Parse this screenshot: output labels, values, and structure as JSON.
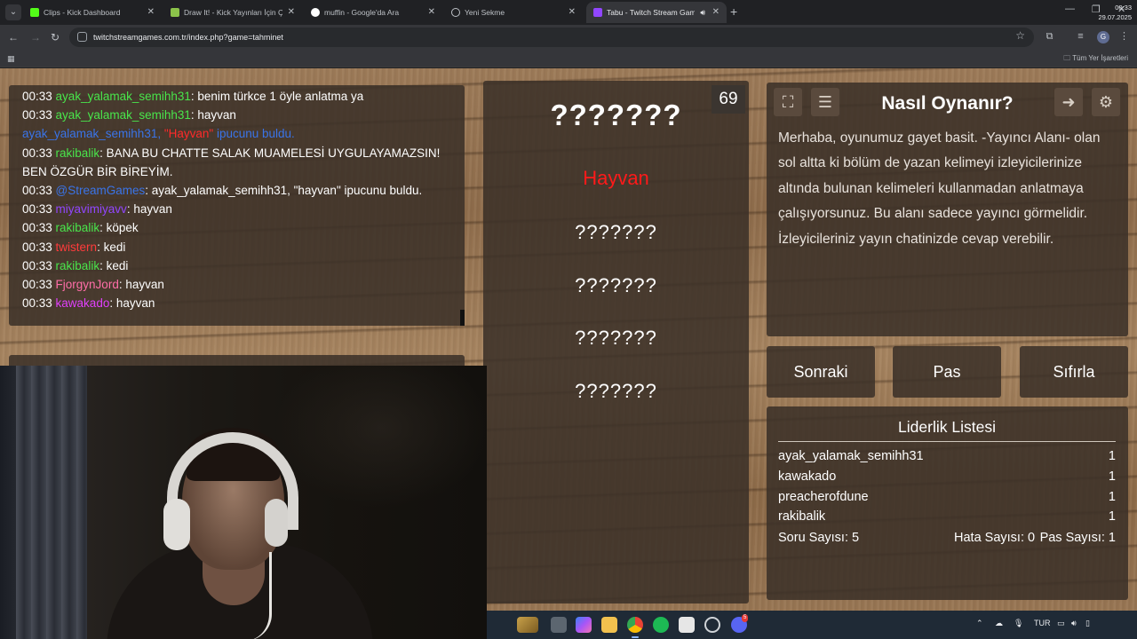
{
  "browser": {
    "tabs": [
      {
        "title": "Clips - Kick Dashboard",
        "favicon_color": "#53fc18"
      },
      {
        "title": "Draw It! - Kick Yayınları İçin Çizim",
        "favicon_color": "#8bc34a"
      },
      {
        "title": "muffin - Google'da Ara",
        "favicon_color": "#ffffff"
      },
      {
        "title": "Yeni Sekme",
        "favicon_color": "#bdc1c6"
      },
      {
        "title": "Tabu - Twitch Stream Games",
        "favicon_color": "#9146ff"
      }
    ],
    "url": "twitchstreamgames.com.tr/index.php?game=tahminet",
    "bookmarks_all_label": "Tüm Yer İşaretleri",
    "profile_initial": "G"
  },
  "chat": {
    "messages": [
      {
        "time": "00:33",
        "user": "ayak_yalamak_semihh31",
        "user_color": "#49e54b",
        "text": ": benim türkce 1 öyle anlatma ya",
        "text_color": "#ffffff"
      },
      {
        "time": "00:33",
        "user": "ayak_yalamak_semihh31",
        "user_color": "#49e54b",
        "text": ": hayvan",
        "text_color": "#ffffff"
      },
      {
        "time": "",
        "user": "ayak_yalamak_semihh31",
        "user_color": "#3a74e8",
        "text": ", \"Hayvan\" ipucunu buldu.",
        "text_color": "#3a74e8",
        "hint_word": "\"Hayvan\"",
        "system": true
      },
      {
        "time": "00:33",
        "user": "rakibalik",
        "user_color": "#49e54b",
        "text": ": BANA BU CHATTE SALAK MUAMELESİ UYGULAYAMAZSIN! BEN ÖZGÜR BİR BİREYİM.",
        "text_color": "#ffffff"
      },
      {
        "time": "00:33",
        "user": "@StreamGames",
        "user_color": "#3a74e8",
        "text": ": ayak_yalamak_semihh31, \"hayvan\" ipucunu buldu.",
        "text_color": "#ffffff"
      },
      {
        "time": "00:33",
        "user": "miyavimiyavv",
        "user_color": "#9146ff",
        "text": ": hayvan",
        "text_color": "#ffffff"
      },
      {
        "time": "00:33",
        "user": "rakibalik",
        "user_color": "#49e54b",
        "text": ": köpek",
        "text_color": "#ffffff"
      },
      {
        "time": "00:33",
        "user": "twistern",
        "user_color": "#ff3b3b",
        "text": ": kedi",
        "text_color": "#ffffff"
      },
      {
        "time": "00:33",
        "user": "rakibalik",
        "user_color": "#49e54b",
        "text": ": kedi",
        "text_color": "#ffffff"
      },
      {
        "time": "00:33",
        "user": "FjorgynJord",
        "user_color": "#ff6ea8",
        "text": ": hayvan",
        "text_color": "#ffffff"
      },
      {
        "time": "00:33",
        "user": "kawakado",
        "user_color": "#e040fb",
        "text": ": hayvan",
        "text_color": "#ffffff"
      }
    ]
  },
  "game": {
    "timer": "69",
    "main_word": "???????",
    "found_hint": "Hayvan",
    "hidden_hints": [
      "???????",
      "???????",
      "???????",
      "???????"
    ]
  },
  "how_to": {
    "title": "Nasıl Oynanır?",
    "text": "Merhaba, oyunumuz gayet basit. -Yayıncı Alanı- olan sol altta ki bölüm de yazan kelimeyi izleyicilerinize altında bulunan kelimeleri kullanmadan anlatmaya çalışıyorsunuz. Bu alanı sadece yayıncı görmelidir. İzleyicileriniz yayın chatinizde cevap verebilir."
  },
  "buttons": {
    "next": "Sonraki",
    "pass": "Pas",
    "reset": "Sıfırla"
  },
  "leaderboard": {
    "title": "Liderlik Listesi",
    "rows": [
      {
        "name": "ayak_yalamak_semihh31",
        "score": "1"
      },
      {
        "name": "kawakado",
        "score": "1"
      },
      {
        "name": "preacherofdune",
        "score": "1"
      },
      {
        "name": "rakibalik",
        "score": "1"
      }
    ],
    "stats": {
      "questions": "Soru Sayısı: 5",
      "errors": "Hata Sayısı: 0",
      "passes": "Pas Sayısı: 1"
    }
  },
  "taskbar": {
    "lang": "TUR",
    "time": "00:33",
    "date": "29.07.2025",
    "discord_badge": "5"
  }
}
